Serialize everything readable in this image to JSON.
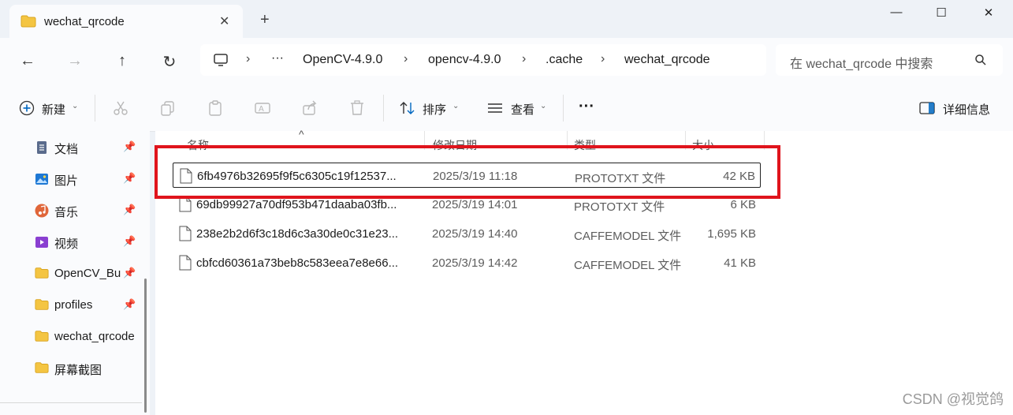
{
  "window": {
    "tab_title": "wechat_qrcode",
    "close_tab": "✕",
    "new_tab": "+",
    "minimize": "—",
    "maximize": "☐",
    "close": "✕"
  },
  "nav": {
    "back": "←",
    "forward": "→",
    "up": "↑",
    "refresh": "↻"
  },
  "address": {
    "overflow": "···",
    "crumbs": [
      "OpenCV-4.9.0",
      "opencv-4.9.0",
      ".cache",
      "wechat_qrcode"
    ],
    "chevron": "›"
  },
  "search": {
    "placeholder": "在 wechat_qrcode 中搜索"
  },
  "toolbar": {
    "new_label": "新建",
    "sort_label": "排序",
    "view_label": "查看",
    "more_label": "···",
    "details_label": "详细信息"
  },
  "sidebar": {
    "items": [
      {
        "label": "文档",
        "icon": "documents-icon",
        "pinned": true
      },
      {
        "label": "图片",
        "icon": "pictures-icon",
        "pinned": true
      },
      {
        "label": "音乐",
        "icon": "music-icon",
        "pinned": true
      },
      {
        "label": "视频",
        "icon": "videos-icon",
        "pinned": true
      },
      {
        "label": "OpenCV_Bu",
        "icon": "folder-icon",
        "pinned": true
      },
      {
        "label": "profiles",
        "icon": "folder-icon",
        "pinned": true
      },
      {
        "label": "wechat_qrcode",
        "icon": "folder-icon",
        "pinned": false
      },
      {
        "label": "屏幕截图",
        "icon": "folder-icon",
        "pinned": false
      }
    ]
  },
  "columns": {
    "name": "名称",
    "date": "修改日期",
    "type": "类型",
    "size": "大小",
    "sort_arrow": "^"
  },
  "files": [
    {
      "name": "6fb4976b32695f9f5c6305c19f12537...",
      "date": "2025/3/19 11:18",
      "type": "PROTOTXT 文件",
      "size": "42 KB"
    },
    {
      "name": "69db99927a70df953b471daaba03fb...",
      "date": "2025/3/19 14:01",
      "type": "PROTOTXT 文件",
      "size": "6 KB"
    },
    {
      "name": "238e2b2d6f3c18d6c3a30de0c31e23...",
      "date": "2025/3/19 14:40",
      "type": "CAFFEMODEL 文件",
      "size": "1,695 KB"
    },
    {
      "name": "cbfcd60361a73beb8c583eea7e8e66...",
      "date": "2025/3/19 14:42",
      "type": "CAFFEMODEL 文件",
      "size": "41 KB"
    }
  ],
  "watermark": "CSDN @视觉鸽",
  "colors": {
    "highlight_box": "#e0141c",
    "folder": "#f4c542",
    "accent": "#0067c0"
  }
}
